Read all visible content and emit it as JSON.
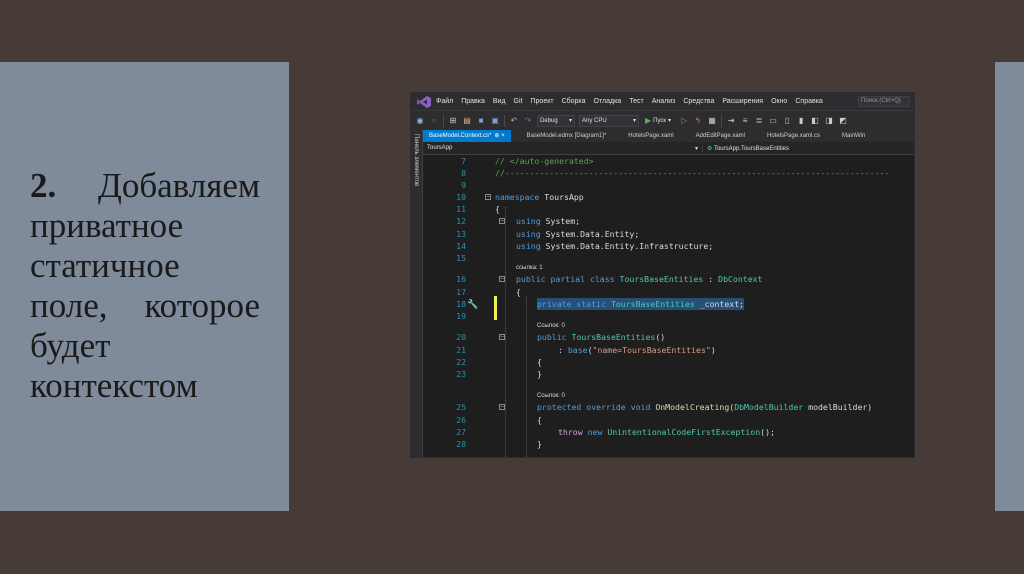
{
  "slide": {
    "number": "2.",
    "lines": [
      "Добавляем",
      "приватное",
      "статичное",
      "поле,",
      "которое",
      "будет",
      "контекстом"
    ]
  },
  "menu": {
    "items": [
      "Файл",
      "Правка",
      "Вид",
      "Git",
      "Проект",
      "Сборка",
      "Отладка",
      "Тест",
      "Анализ",
      "Средства",
      "Расширения",
      "Окно",
      "Справка"
    ],
    "search_placeholder": "Поиск (Ctrl+Q)"
  },
  "toolbar": {
    "config": "Debug",
    "platform": "Any CPU",
    "run_label": "Пуск"
  },
  "side_panel_label": "Панель элементов",
  "tabs": [
    {
      "label": "BaseModel.Context.cs*",
      "close": "⊕ ×"
    },
    {
      "label": "BaseModel.edmx [Diagram1]*"
    },
    {
      "label": "HotelsPage.xaml"
    },
    {
      "label": "AddEditPage.xaml"
    },
    {
      "label": "HotelsPage.xaml.cs"
    },
    {
      "label": "MainWin"
    }
  ],
  "nav": {
    "project": "ToursApp",
    "member": "ToursApp.ToursBaseEntities"
  },
  "code": {
    "l7": "// </auto-generated>",
    "l8": "//------------------------------------------------------------------------------",
    "l9": "",
    "l10_kw": "namespace",
    "l10_name": " ToursApp",
    "l11": "{",
    "l12_kw": "using",
    "l12_rest": " System;",
    "l13_kw": "using",
    "l13_rest": " System.Data.Entity;",
    "l14_kw": "using",
    "l14_rest": " System.Data.Entity.Infrastructure;",
    "lens1": "ссылка: 1",
    "l16_kw": "public partial class",
    "l16_type": "ToursBaseEntities",
    "l16_sep": " : ",
    "l16_base": "DbContext",
    "l17": "{",
    "l18_kw": "private static",
    "l18_type": "ToursBaseEntities",
    "l18_rest": " _context;",
    "lens2": "Ссылок: 0",
    "l20_kw": "public",
    "l20_type": "ToursBaseEntities",
    "l20_rest": "()",
    "l21_a": ": ",
    "l21_kw": "base",
    "l21_b": "(",
    "l21_str": "\"name=ToursBaseEntities\"",
    "l21_c": ")",
    "l22": "{",
    "l23": "}",
    "lens3": "Ссылок: 0",
    "l25_kw": "protected override void",
    "l25_fn": "OnModelCreating",
    "l25_b": "(",
    "l25_type": "DbModelBuilder",
    "l25_rest": " modelBuilder)",
    "l26": "{",
    "l27_kw": "throw",
    "l27_kw2": "new",
    "l27_type": "UnintentionalCodeFirstException",
    "l27_rest": "();",
    "l28": "}"
  },
  "line_numbers": [
    "7",
    "8",
    "9",
    "10",
    "11",
    "12",
    "13",
    "14",
    "15",
    "16",
    "17",
    "18",
    "19",
    "20",
    "21",
    "22",
    "23",
    "25",
    "26",
    "27",
    "28"
  ]
}
